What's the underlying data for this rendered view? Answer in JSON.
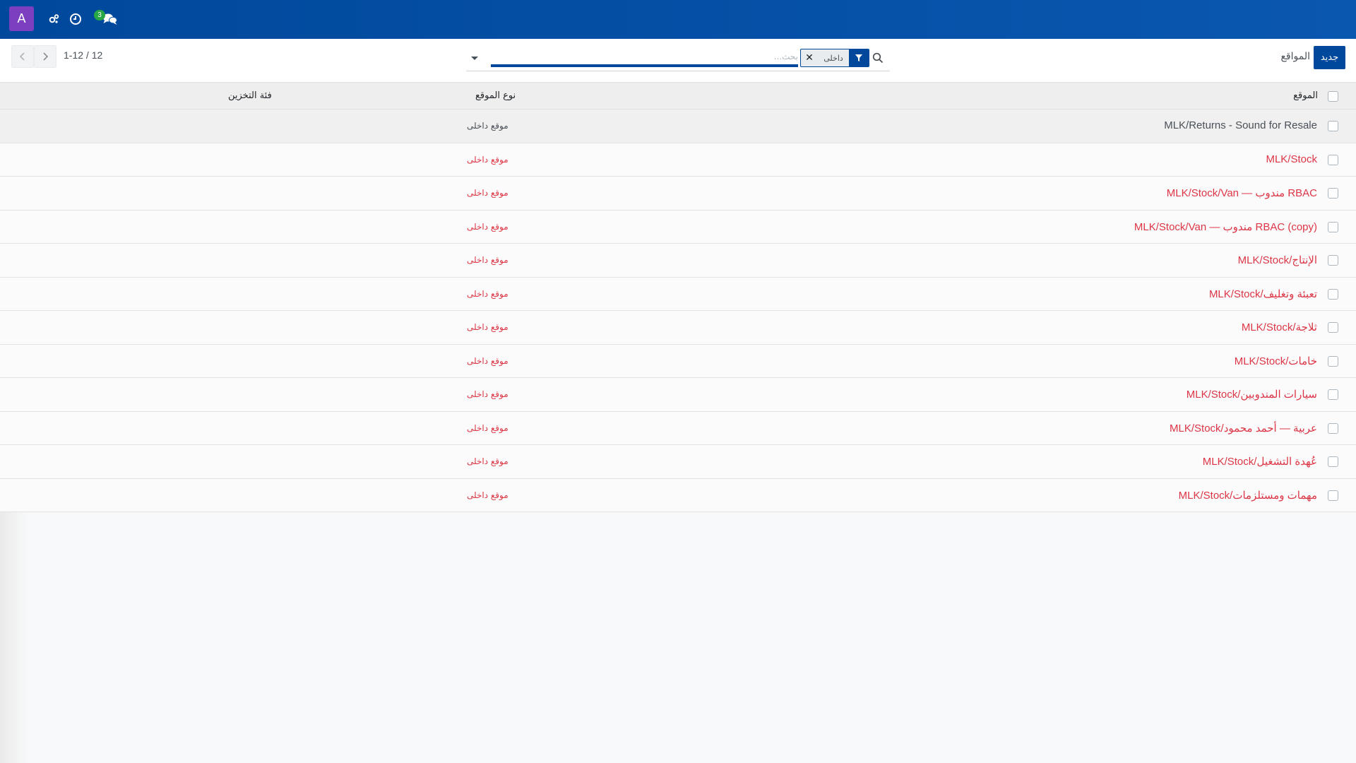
{
  "navbar": {
    "avatar_letter": "A",
    "icons": [
      "settings-icon",
      "clock-icon",
      "chat-icon"
    ],
    "messages_count": "3",
    "colors": {
      "navbar": "#00489b",
      "avatar": "#7b3fbf",
      "badge": "#28a745"
    }
  },
  "control_panel": {
    "pager": "1-12 / 12",
    "search": {
      "placeholder": "بحث...",
      "facet_value": "داخلى",
      "dropdown_icon": "caret-down-icon",
      "filter_icon": "filter-icon",
      "search_icon": "search-icon"
    },
    "breadcrumb": "المواقع",
    "new_button": "جديد"
  },
  "list": {
    "headers": {
      "location": "الموقع",
      "location_type": "نوع الموقع",
      "storage_category": "فئة التخزين"
    },
    "rows": [
      {
        "location": "MLK/Returns - Sound for Resale",
        "type": "موقع داخلى",
        "category": ""
      },
      {
        "location": "MLK/Stock",
        "type": "موقع داخلى",
        "category": ""
      },
      {
        "location": "MLK/Stock/Van — مندوب RBAC",
        "type": "موقع داخلى",
        "category": ""
      },
      {
        "location": "MLK/Stock/Van — مندوب RBAC (copy)",
        "type": "موقع داخلى",
        "category": ""
      },
      {
        "location": "MLK/Stock/الإنتاج",
        "type": "موقع داخلى",
        "category": ""
      },
      {
        "location": "MLK/Stock/تعبئة وتغليف",
        "type": "موقع داخلى",
        "category": ""
      },
      {
        "location": "MLK/Stock/ثلاجة",
        "type": "موقع داخلى",
        "category": ""
      },
      {
        "location": "MLK/Stock/خامات",
        "type": "موقع داخلى",
        "category": ""
      },
      {
        "location": "MLK/Stock/سيارات المندوبين",
        "type": "موقع داخلى",
        "category": ""
      },
      {
        "location": "MLK/Stock/عربية — أحمد محمود",
        "type": "موقع داخلى",
        "category": ""
      },
      {
        "location": "MLK/Stock/عُهدة التشغيل",
        "type": "موقع داخلى",
        "category": ""
      },
      {
        "location": "MLK/Stock/مهمات ومستلزمات",
        "type": "موقع داخلى",
        "category": ""
      }
    ]
  }
}
